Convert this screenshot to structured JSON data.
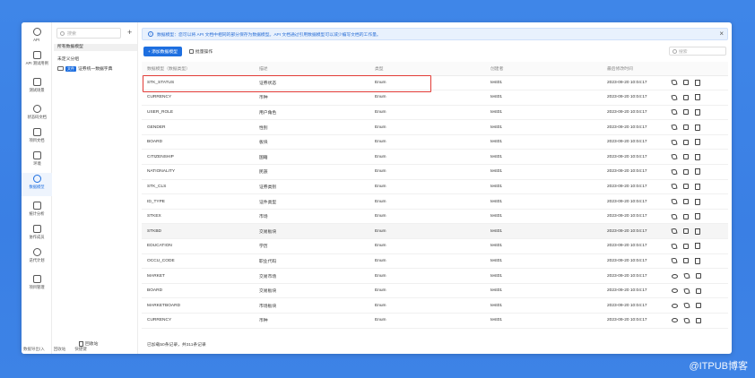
{
  "rail": {
    "items": [
      {
        "label": "API",
        "icon": "api-icon"
      },
      {
        "label": "API 测试用例",
        "icon": "test-case-icon"
      },
      {
        "label": "测试场景",
        "icon": "scenario-icon"
      },
      {
        "label": "状态码文档",
        "icon": "status-doc-icon"
      },
      {
        "label": "项目文档",
        "icon": "doc-icon"
      },
      {
        "label": "环境",
        "icon": "environment-icon"
      },
      {
        "label": "数据模型",
        "icon": "data-model-icon"
      },
      {
        "label": "统计分析",
        "icon": "stats-icon"
      },
      {
        "label": "协作成员",
        "icon": "members-icon"
      },
      {
        "label": "迭代计划",
        "icon": "calendar-icon"
      },
      {
        "label": "项目管理",
        "icon": "settings-icon"
      }
    ],
    "active_index": 6,
    "bottom": [
      "数据导出/入",
      "回收站",
      "快捷键"
    ]
  },
  "tree": {
    "search_placeholder": "搜索",
    "add_label": "+",
    "all_label": "所有数据模型",
    "ungrouped_label": "未定义分组",
    "folder_tag": "文件",
    "folder_label": "证券统一数据字典",
    "recycle_label": "回收站"
  },
  "banner": {
    "text": "数据模型：您可以将 API 文档中相同的部分保存为数据模型。API 文档通过引用数据模型可以减少编写文档的工作量。"
  },
  "toolbar": {
    "add_label": "+ 添加数据模型",
    "batch_label": "批量操作",
    "search_placeholder": "搜索"
  },
  "table": {
    "columns": [
      "数据模型（数据类型）",
      "描述",
      "类型",
      "创建者",
      "最后修改时间",
      ""
    ],
    "rows": [
      {
        "name": "STK_STATUS",
        "desc": "证券状态",
        "type": "Enum",
        "creator": "test01",
        "time": "2023-09-20 10:04:17"
      },
      {
        "name": "CURRENCY",
        "desc": "币种",
        "type": "Enum",
        "creator": "test01",
        "time": "2023-09-20 10:04:17"
      },
      {
        "name": "USER_ROLE",
        "desc": "用户角色",
        "type": "Enum",
        "creator": "test01",
        "time": "2023-09-20 10:04:17"
      },
      {
        "name": "GENDER",
        "desc": "性别",
        "type": "Enum",
        "creator": "test01",
        "time": "2023-09-20 10:04:17"
      },
      {
        "name": "BOARD",
        "desc": "板块",
        "type": "Enum",
        "creator": "test01",
        "time": "2023-09-20 10:04:17"
      },
      {
        "name": "CITIZENSHIP",
        "desc": "国籍",
        "type": "Enum",
        "creator": "test01",
        "time": "2023-09-20 10:04:17"
      },
      {
        "name": "NATIONALITY",
        "desc": "民族",
        "type": "Enum",
        "creator": "test01",
        "time": "2023-09-20 10:04:17"
      },
      {
        "name": "STK_CLS",
        "desc": "证券类别",
        "type": "Enum",
        "creator": "test01",
        "time": "2023-09-20 10:04:17"
      },
      {
        "name": "ID_TYPE",
        "desc": "证件类型",
        "type": "Enum",
        "creator": "test01",
        "time": "2023-09-20 10:04:17"
      },
      {
        "name": "STKEX",
        "desc": "市场",
        "type": "Enum",
        "creator": "test01",
        "time": "2023-09-20 10:04:17"
      },
      {
        "name": "STKBD",
        "desc": "交易板块",
        "type": "Enum",
        "creator": "test01",
        "time": "2023-09-20 10:04:17"
      },
      {
        "name": "EDUCATION",
        "desc": "学历",
        "type": "Enum",
        "creator": "test01",
        "time": "2023-09-20 10:04:17"
      },
      {
        "name": "OCCU_CODE",
        "desc": "职业代码",
        "type": "Enum",
        "creator": "test01",
        "time": "2023-09-20 10:04:17"
      },
      {
        "name": "MARKET",
        "desc": "交易市场",
        "type": "Enum",
        "creator": "test01",
        "time": "2023-09-20 10:04:17"
      },
      {
        "name": "BOARD",
        "desc": "交易板块",
        "type": "Enum",
        "creator": "test01",
        "time": "2023-09-20 10:04:17"
      },
      {
        "name": "MARKETBOARD",
        "desc": "市场板块",
        "type": "Enum",
        "creator": "test01",
        "time": "2023-09-20 10:04:17"
      },
      {
        "name": "CURRENCY",
        "desc": "币种",
        "type": "Enum",
        "creator": "test01",
        "time": "2023-09-20 10:04:17"
      }
    ],
    "highlighted_row_index": 10,
    "outlined_row_index": 0
  },
  "footer": {
    "text": "已加载50条记录，共311条记录"
  },
  "watermark": {
    "text": "@ITPUB博客"
  },
  "colors": {
    "accent": "#1e6fe0",
    "outline": "#e23b36",
    "background": "#3d83e6"
  }
}
